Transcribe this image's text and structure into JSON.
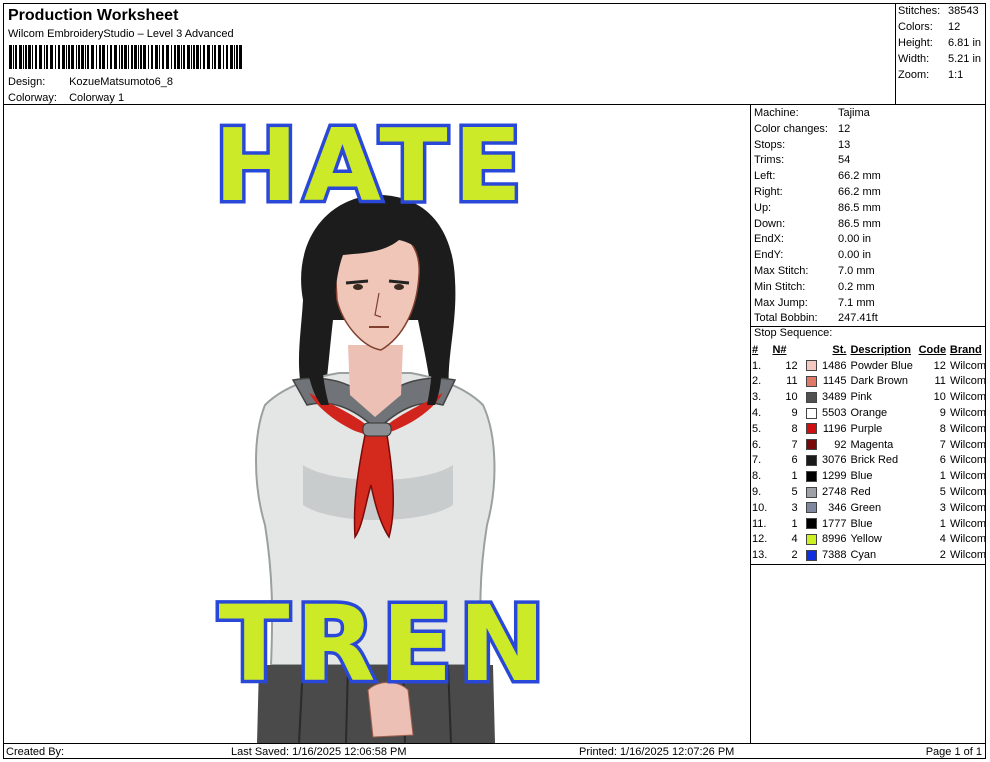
{
  "header": {
    "title": "Production Worksheet",
    "subtitle": "Wilcom EmbroideryStudio – Level 3 Advanced",
    "design_label": "Design:",
    "design_value": "KozueMatsumoto6_8",
    "colorway_label": "Colorway:",
    "colorway_value": "Colorway 1"
  },
  "stats": [
    {
      "label": "Stitches:",
      "value": "38543"
    },
    {
      "label": "Colors:",
      "value": "12"
    },
    {
      "label": "Height:",
      "value": "6.81 in"
    },
    {
      "label": "Width:",
      "value": "5.21 in"
    },
    {
      "label": "Zoom:",
      "value": "1:1"
    }
  ],
  "machine": [
    {
      "label": "Machine:",
      "value": "Tajima"
    },
    {
      "label": "Color changes:",
      "value": "12"
    },
    {
      "label": "Stops:",
      "value": "13"
    },
    {
      "label": "Trims:",
      "value": "54"
    },
    {
      "label": "Left:",
      "value": "66.2 mm"
    },
    {
      "label": "Right:",
      "value": "66.2 mm"
    },
    {
      "label": "Up:",
      "value": "86.5 mm"
    },
    {
      "label": "Down:",
      "value": "86.5 mm"
    },
    {
      "label": "EndX:",
      "value": "0.00 in"
    },
    {
      "label": "EndY:",
      "value": "0.00 in"
    },
    {
      "label": "Max Stitch:",
      "value": "7.0 mm"
    },
    {
      "label": "Min Stitch:",
      "value": "0.2 mm"
    },
    {
      "label": "Max Jump:",
      "value": "7.1 mm"
    },
    {
      "label": "Total Bobbin:",
      "value": "247.41ft"
    }
  ],
  "stop_sequence": {
    "title": "Stop Sequence:",
    "headers": [
      "#",
      "N#",
      "St.",
      "Description",
      "Code",
      "Brand"
    ],
    "rows": [
      {
        "num": "1.",
        "n": "12",
        "color": "#f2c8c0",
        "st": "1486",
        "desc": "Powder Blue",
        "code": "12",
        "brand": "Wilcom"
      },
      {
        "num": "2.",
        "n": "11",
        "color": "#e07868",
        "st": "1145",
        "desc": "Dark Brown",
        "code": "11",
        "brand": "Wilcom"
      },
      {
        "num": "3.",
        "n": "10",
        "color": "#505050",
        "st": "3489",
        "desc": "Pink",
        "code": "10",
        "brand": "Wilcom"
      },
      {
        "num": "4.",
        "n": "9",
        "color": "#ffffff",
        "st": "5503",
        "desc": "Orange",
        "code": "9",
        "brand": "Wilcom"
      },
      {
        "num": "5.",
        "n": "8",
        "color": "#d01010",
        "st": "1196",
        "desc": "Purple",
        "code": "8",
        "brand": "Wilcom"
      },
      {
        "num": "6.",
        "n": "7",
        "color": "#7a0a0a",
        "st": "92",
        "desc": "Magenta",
        "code": "7",
        "brand": "Wilcom"
      },
      {
        "num": "7.",
        "n": "6",
        "color": "#1a1a1a",
        "st": "3076",
        "desc": "Brick Red",
        "code": "6",
        "brand": "Wilcom"
      },
      {
        "num": "8.",
        "n": "1",
        "color": "#000000",
        "st": "1299",
        "desc": "Blue",
        "code": "1",
        "brand": "Wilcom"
      },
      {
        "num": "9.",
        "n": "5",
        "color": "#a0a0a8",
        "st": "2748",
        "desc": "Red",
        "code": "5",
        "brand": "Wilcom"
      },
      {
        "num": "10.",
        "n": "3",
        "color": "#8088a0",
        "st": "346",
        "desc": "Green",
        "code": "3",
        "brand": "Wilcom"
      },
      {
        "num": "11.",
        "n": "1",
        "color": "#000000",
        "st": "1777",
        "desc": "Blue",
        "code": "1",
        "brand": "Wilcom"
      },
      {
        "num": "12.",
        "n": "4",
        "color": "#ccf020",
        "st": "8996",
        "desc": "Yellow",
        "code": "4",
        "brand": "Wilcom"
      },
      {
        "num": "13.",
        "n": "2",
        "color": "#1030e0",
        "st": "7388",
        "desc": "Cyan",
        "code": "2",
        "brand": "Wilcom"
      }
    ]
  },
  "design": {
    "top_text": "HATE",
    "bottom_text": "TREN",
    "letter_fill": "#ccea28",
    "letter_outline": "#2a48d8"
  },
  "footer": {
    "created_by": "Created By:",
    "last_saved": "Last Saved: 1/16/2025 12:06:58 PM",
    "printed": "Printed: 1/16/2025 12:07:26 PM",
    "page": "Page 1 of 1"
  }
}
